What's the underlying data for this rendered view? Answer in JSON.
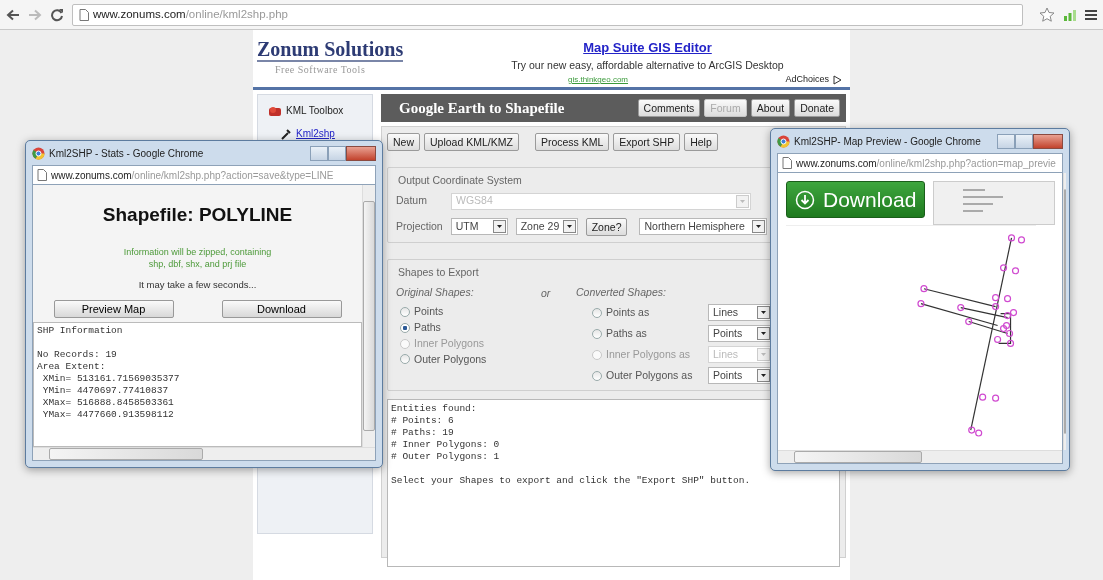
{
  "browser": {
    "url": {
      "host": "www.zonums.com",
      "path": "/online/kml2shp.php"
    }
  },
  "site": {
    "logo": {
      "title": "Zonum Solutions",
      "tagline": "Free Software Tools"
    },
    "ad": {
      "title": "Map Suite GIS Editor",
      "text": "Try our new easy, affordable alternative to ArcGIS Desktop",
      "url": "gis.thinkgeo.com",
      "choices": "AdChoices"
    }
  },
  "sidebar": {
    "items": [
      {
        "label": "KML Toolbox",
        "kind": "toolbox"
      },
      {
        "label": "Kml2shp",
        "kind": "tool"
      }
    ]
  },
  "tool": {
    "title": "Google Earth to Shapefile",
    "nav_buttons": [
      {
        "label": "Comments",
        "disabled": false
      },
      {
        "label": "Forum",
        "disabled": true
      },
      {
        "label": "About",
        "disabled": false
      },
      {
        "label": "Donate",
        "disabled": false
      }
    ],
    "file_buttons": [
      "New",
      "Upload KML/KMZ"
    ],
    "action_buttons": [
      "Process KML",
      "Export SHP",
      "Help"
    ],
    "coordinate_system": {
      "legend": "Output Coordinate System",
      "datum_label": "Datum",
      "datum": "WGS84",
      "datum_disabled": true,
      "projection_label": "Projection",
      "projection": "UTM",
      "zone": "Zone 29",
      "zone_button": "Zone?",
      "hemisphere": "Northern Hemisphere"
    },
    "shapes": {
      "legend": "Shapes to Export",
      "original_heading": "Original Shapes:",
      "or": "or",
      "converted_heading": "Converted Shapes:",
      "original": [
        {
          "label": "Points",
          "selected": false,
          "disabled": false
        },
        {
          "label": "Paths",
          "selected": true,
          "disabled": false
        },
        {
          "label": "Inner Polygons",
          "selected": false,
          "disabled": true
        },
        {
          "label": "Outer Polygons",
          "selected": false,
          "disabled": false
        }
      ],
      "converted": [
        {
          "label": "Points as",
          "value": "Lines",
          "selected": false,
          "disabled": false
        },
        {
          "label": "Paths as",
          "value": "Points",
          "selected": false,
          "disabled": false
        },
        {
          "label": "Inner Polygons as",
          "value": "Lines",
          "selected": false,
          "disabled": true
        },
        {
          "label": "Outer Polygons as",
          "value": "Points",
          "selected": false,
          "disabled": false
        }
      ]
    },
    "output": "Entities found:\n# Points: 6\n# Paths: 19\n# Inner Polygons: 0\n# Outer Polygons: 1\n\nSelect your Shapes to export and click the \"Export SHP\" button."
  },
  "stats_window": {
    "title": "Kml2SHP - Stats - Google Chrome",
    "url": {
      "host": "www.zonums.com",
      "path": "/online/kml2shp.php?action=save&type=LINE"
    },
    "heading": "Shapefile: POLYLINE",
    "info": [
      "Information will be zipped, containing",
      "shp, dbf, shx, and prj file"
    ],
    "note": "It may take a few seconds...",
    "buttons": [
      "Preview Map",
      "Download"
    ],
    "shp_info": "SHP Information\n\nNo Records: 19\nArea Extent:\n XMin= 513161.71569035377\n YMin= 4470697.77410837\n XMax= 516888.8458503361\n YMax= 4477660.913598112"
  },
  "preview_window": {
    "title": "Kml2SHP- Map Preview - Google Chrome",
    "url": {
      "host": "www.zonums.com",
      "path": "/online/kml2shp.php?action=map_previe"
    },
    "download_button": "Download"
  }
}
